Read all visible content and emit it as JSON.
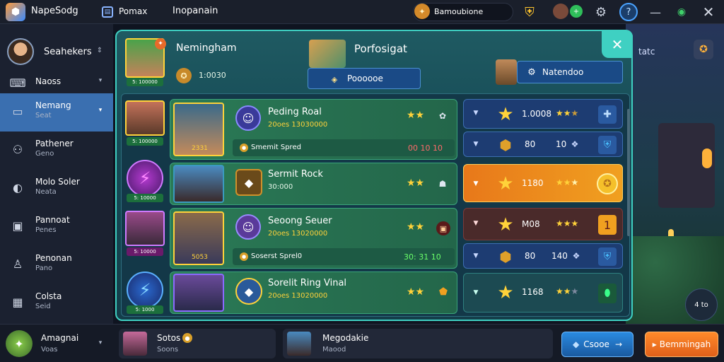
{
  "topbar": {
    "app_title": "NapeSodg",
    "tab1": "Pomax",
    "tab2": "Inopanain",
    "currency": "Bamoubione"
  },
  "sidebar": {
    "profile_name": "Seahekers",
    "items": [
      {
        "l1": "Naoss",
        "l2": ""
      },
      {
        "l1": "Nemang",
        "l2": "Seat"
      },
      {
        "l1": "Pathener",
        "l2": "Geno"
      },
      {
        "l1": "Molo Soler",
        "l2": "Neata"
      },
      {
        "l1": "Pannoat",
        "l2": "Penes"
      },
      {
        "l1": "Penonan",
        "l2": "Pano"
      },
      {
        "l1": "Colsta",
        "l2": "Seid"
      }
    ],
    "footer_name": "Amagnai",
    "footer_sub": "Voas"
  },
  "modal": {
    "player_name": "Nemingham",
    "player_coins": "1:0030",
    "player_badge": "5: 100000",
    "title": "Porfosigat",
    "search_value": "Poooooe",
    "right_button": "Natendoo",
    "rows": [
      {
        "badge": "5: 100000",
        "level": "2331",
        "name": "Peding Roal",
        "stats": "20oes 13030000",
        "sub": "Smemit Spred",
        "nums": "00 10 10",
        "rank_value": "1.0008",
        "gold_value": "80",
        "gold_value2": "10"
      },
      {
        "badge": "5: 10000",
        "level": "",
        "name": "Sermit Rock",
        "stats": "30:000",
        "sub": "",
        "nums": "",
        "rank_value": "1180",
        "gold_value": "",
        "gold_value2": ""
      },
      {
        "badge": "5: 10000",
        "level": "5053",
        "name": "Seoong Seuer",
        "stats": "20oes 13020000",
        "sub": "Soserst Sprel0",
        "nums": "30: 31 10",
        "rank_value": "M08",
        "gold_value": "80",
        "gold_value2": "140"
      },
      {
        "badge": "5: 1000",
        "level": "",
        "name": "Sorelit Ring Vinal",
        "stats": "20oes 13020000",
        "sub": "",
        "nums": "",
        "rank_value": "1168",
        "gold_value": "",
        "gold_value2": ""
      }
    ]
  },
  "side_right": {
    "label": "tatc",
    "bottom_label": "4 to"
  },
  "bottom": {
    "card1_name": "Sotos",
    "card1_sub": "Soons",
    "card2_name": "Megodakie",
    "card2_sub": "Maood",
    "btn1": "Csooe",
    "btn2": "Bemmingah"
  }
}
